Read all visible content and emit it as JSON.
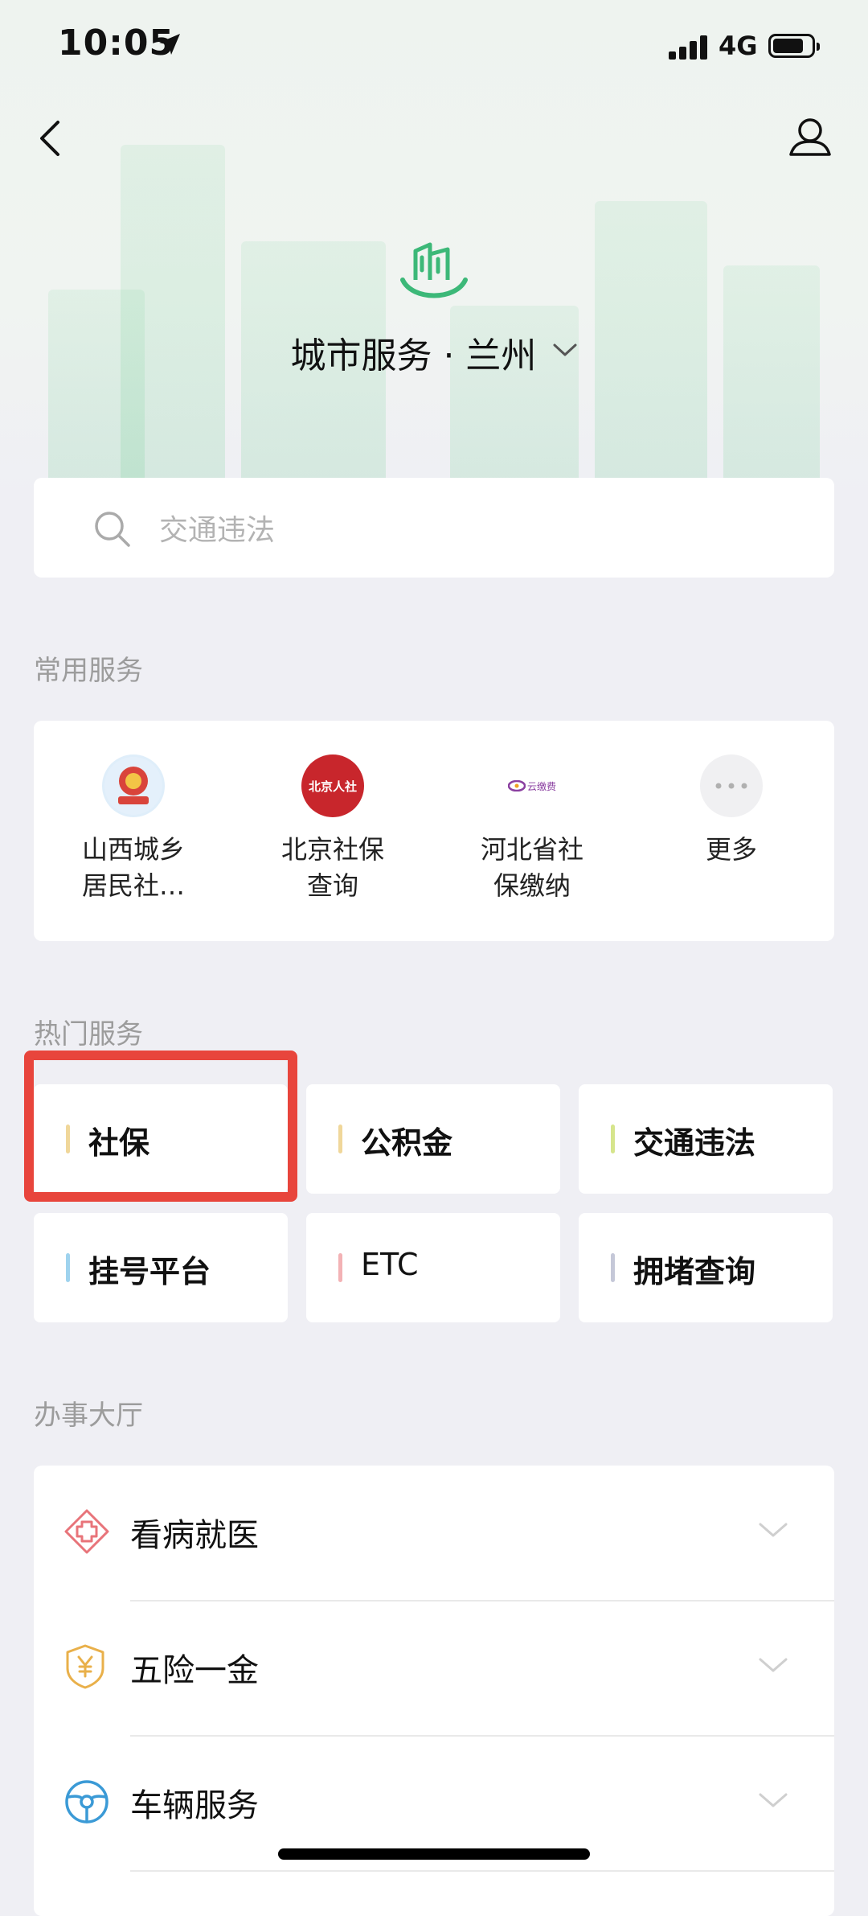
{
  "status_bar": {
    "time": "10:05",
    "network": "4G"
  },
  "header": {
    "title": "城市服务 · 兰州"
  },
  "search": {
    "placeholder": "交通违法"
  },
  "common_services": {
    "title": "常用服务",
    "items": [
      {
        "label": "山西城乡\n居民社…",
        "icon": "shanxi-social-insurance-emblem-icon"
      },
      {
        "label": "北京社保\n查询",
        "icon": "beijing-renshe-icon",
        "icon_text": "北京人社"
      },
      {
        "label": "河北省社\n保缴纳",
        "icon": "yunjiaofei-icon",
        "icon_text": "云缴费"
      },
      {
        "label": "更多",
        "icon": "more-dots-icon"
      }
    ]
  },
  "hot_services": {
    "title": "热门服务",
    "items": [
      {
        "label": "社保",
        "color": "#f0d79a"
      },
      {
        "label": "公积金",
        "color": "#f0d79a"
      },
      {
        "label": "交通违法",
        "color": "#d6e58c"
      },
      {
        "label": "挂号平台",
        "color": "#9fd3ee"
      },
      {
        "label": "ETC",
        "color": "#f3b2b5"
      },
      {
        "label": "拥堵查询",
        "color": "#c5c8d8"
      }
    ],
    "highlight_color": "#e8453c"
  },
  "hall": {
    "title": "办事大厅",
    "items": [
      {
        "label": "看病就医",
        "icon": "medical-cross-icon",
        "color": "#e8747a"
      },
      {
        "label": "五险一金",
        "icon": "yen-shield-icon",
        "color": "#e9b04a"
      },
      {
        "label": "车辆服务",
        "icon": "steering-wheel-icon",
        "color": "#3b9ad6"
      }
    ]
  },
  "colors": {
    "accent_green": "#3cb878",
    "background": "#efeff4"
  }
}
